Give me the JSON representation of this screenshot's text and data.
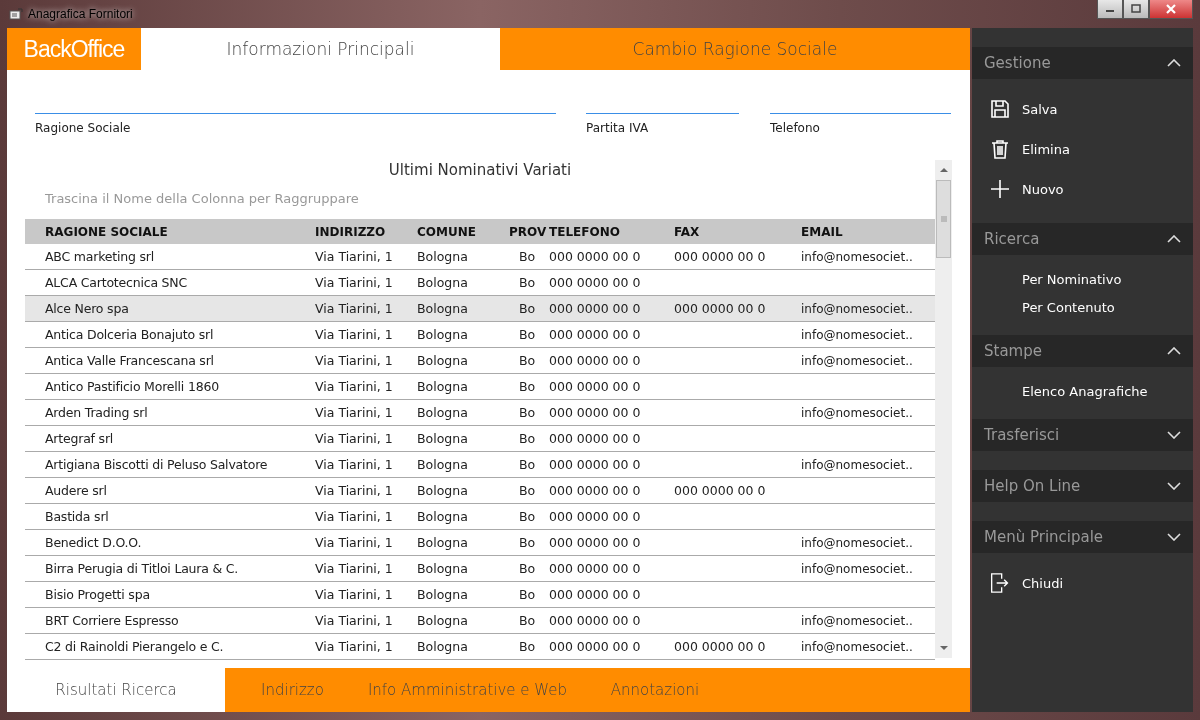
{
  "window": {
    "title": "Anagrafica Fornitori"
  },
  "logo": "BackOffice",
  "top_tabs": [
    {
      "label": "Informazioni Principali",
      "selected": true
    },
    {
      "label": "Cambio Ragione Sociale",
      "selected": false
    }
  ],
  "fields": [
    {
      "label": "Ragione Sociale"
    },
    {
      "label": "Partita IVA"
    },
    {
      "label": "Telefono"
    }
  ],
  "grid": {
    "title": "Ultimi Nominativi Variati",
    "group_hint": "Trascina il Nome della Colonna per Raggruppare",
    "columns": [
      "RAGIONE SOCIALE",
      "INDIRIZZO",
      "COMUNE",
      "PROV",
      "TELEFONO",
      "FAX",
      "EMAIL"
    ],
    "rows": [
      {
        "selected": false,
        "cells": [
          "ABC marketing srl",
          "Via Tiarini, 1",
          "Bologna",
          "Bo",
          "000 0000 00 0",
          "000 0000 00 0",
          "info@nomesociet.."
        ]
      },
      {
        "selected": false,
        "cells": [
          "ALCA Cartotecnica SNC",
          "Via Tiarini, 1",
          "Bologna",
          "Bo",
          "000 0000 00 0",
          "",
          ""
        ]
      },
      {
        "selected": true,
        "cells": [
          "Alce Nero spa",
          "Via Tiarini, 1",
          "Bologna",
          "Bo",
          "000 0000 00 0",
          "000 0000 00 0",
          "info@nomesociet.."
        ]
      },
      {
        "selected": false,
        "cells": [
          "Antica Dolceria Bonajuto srl",
          "Via Tiarini, 1",
          "Bologna",
          "Bo",
          "000 0000 00 0",
          "",
          "info@nomesociet.."
        ]
      },
      {
        "selected": false,
        "cells": [
          "Antica Valle Francescana srl",
          "Via Tiarini, 1",
          "Bologna",
          "Bo",
          "000 0000 00 0",
          "",
          "info@nomesociet.."
        ]
      },
      {
        "selected": false,
        "cells": [
          "Antico Pastificio Morelli 1860",
          "Via Tiarini, 1",
          "Bologna",
          "Bo",
          "000 0000 00 0",
          "",
          ""
        ]
      },
      {
        "selected": false,
        "cells": [
          "Arden Trading srl",
          "Via Tiarini, 1",
          "Bologna",
          "Bo",
          "000 0000 00 0",
          "",
          "info@nomesociet.."
        ]
      },
      {
        "selected": false,
        "cells": [
          "Artegraf srl",
          "Via Tiarini, 1",
          "Bologna",
          "Bo",
          "000 0000 00 0",
          "",
          ""
        ]
      },
      {
        "selected": false,
        "cells": [
          "Artigiana Biscotti di Peluso Salvatore",
          "Via Tiarini, 1",
          "Bologna",
          "Bo",
          "000 0000 00 0",
          "",
          "info@nomesociet.."
        ]
      },
      {
        "selected": false,
        "cells": [
          "Audere srl",
          "Via Tiarini, 1",
          "Bologna",
          "Bo",
          "000 0000 00 0",
          "000 0000 00 0",
          ""
        ]
      },
      {
        "selected": false,
        "cells": [
          "Bastida srl",
          "Via Tiarini, 1",
          "Bologna",
          "Bo",
          "000 0000 00 0",
          "",
          ""
        ]
      },
      {
        "selected": false,
        "cells": [
          "Benedict D.O.O.",
          "Via Tiarini, 1",
          "Bologna",
          "Bo",
          "000 0000 00 0",
          "",
          "info@nomesociet.."
        ]
      },
      {
        "selected": false,
        "cells": [
          "Birra Perugia di Titloi Laura & C.",
          "Via Tiarini, 1",
          "Bologna",
          "Bo",
          "000 0000 00 0",
          "",
          "info@nomesociet.."
        ]
      },
      {
        "selected": false,
        "cells": [
          "Bisio Progetti spa",
          "Via Tiarini, 1",
          "Bologna",
          "Bo",
          "000 0000 00 0",
          "",
          ""
        ]
      },
      {
        "selected": false,
        "cells": [
          "BRT Corriere Espresso",
          "Via Tiarini, 1",
          "Bologna",
          "Bo",
          "000 0000 00 0",
          "",
          "info@nomesociet.."
        ]
      },
      {
        "selected": false,
        "cells": [
          "C2 di Rainoldi Pierangelo e C.",
          "Via Tiarini, 1",
          "Bologna",
          "Bo",
          "000 0000 00 0",
          "000 0000 00 0",
          "info@nomesociet.."
        ]
      }
    ]
  },
  "bottom_tabs": [
    {
      "label": "Risultati Ricerca",
      "selected": true
    },
    {
      "label": "Indirizzo",
      "selected": false
    },
    {
      "label": "Info Amministrative e Web",
      "selected": false
    },
    {
      "label": "Annotazioni",
      "selected": false
    }
  ],
  "sidebar": [
    {
      "title": "Gestione",
      "expanded": true,
      "items": [
        {
          "label": "Salva",
          "kind": "save"
        },
        {
          "label": "Elimina",
          "kind": "delete"
        },
        {
          "label": "Nuovo",
          "kind": "new"
        }
      ]
    },
    {
      "title": "Ricerca",
      "expanded": true,
      "items": [
        {
          "label": "Per Nominativo",
          "kind": "text"
        },
        {
          "label": "Per Contenuto",
          "kind": "text"
        }
      ]
    },
    {
      "title": "Stampe",
      "expanded": true,
      "items": [
        {
          "label": "Elenco Anagrafiche",
          "kind": "text"
        }
      ]
    },
    {
      "title": "Trasferisci",
      "expanded": false
    },
    {
      "title": "Help On Line",
      "expanded": false
    },
    {
      "title": "Menù Principale",
      "expanded": false,
      "items": [
        {
          "label": "Chiudi",
          "kind": "exit"
        }
      ]
    }
  ]
}
